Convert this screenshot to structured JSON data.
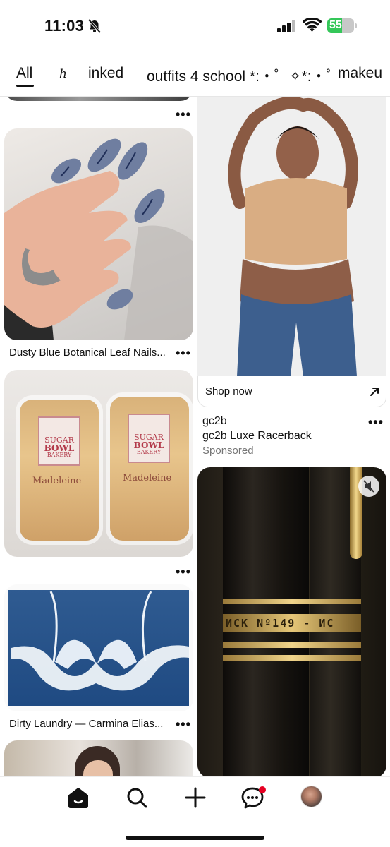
{
  "status_bar": {
    "time": "11:03",
    "battery": "55"
  },
  "tabs": [
    {
      "label": "All",
      "active": true
    },
    {
      "label": "h",
      "active": false
    },
    {
      "label": "inked",
      "active": false
    },
    {
      "label": "outfits 4 school *:・゜✧*:・゜",
      "active": false
    },
    {
      "label": "makeu",
      "active": false
    }
  ],
  "pins": {
    "nails_title": "Dusty Blue Botanical Leaf Nails...",
    "madeleine": {
      "brand": "SUGAR",
      "brand2": "BOWL",
      "brand3": "BAKERY",
      "product": "Madeleine"
    },
    "laundry_title": "Dirty Laundry — Carmina Elias...",
    "ad": {
      "cta": "Shop now",
      "advertiser": "gc2b",
      "title": "gc2b Luxe Racerback",
      "label": "Sponsored"
    },
    "pen_engraving": "ИСК Nº149 - ИС"
  },
  "colors": {
    "accent": "#e60023",
    "battery_green": "#34c759"
  }
}
